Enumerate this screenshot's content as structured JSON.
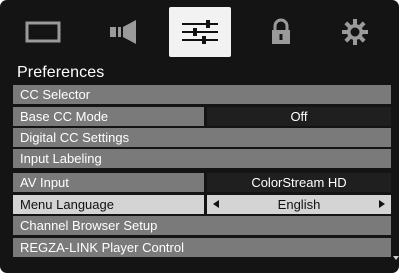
{
  "tabs": [
    {
      "icon": "picture-icon",
      "active": false
    },
    {
      "icon": "sound-icon",
      "active": false
    },
    {
      "icon": "preferences-sliders-icon",
      "active": true
    },
    {
      "icon": "lock-icon",
      "active": false
    },
    {
      "icon": "setup-gear-icon",
      "active": false
    }
  ],
  "menu": {
    "title": "Preferences",
    "items": [
      {
        "label": "CC Selector",
        "value": null
      },
      {
        "label": "Base CC Mode",
        "value": "Off"
      },
      {
        "label": "Digital CC Settings",
        "value": null
      },
      {
        "label": "Input Labeling",
        "value": null
      },
      {
        "label": "AV Input",
        "value": "ColorStream HD"
      },
      {
        "label": "Menu Language",
        "value": "English",
        "selected": true
      },
      {
        "label": "Channel Browser Setup",
        "value": null
      },
      {
        "label": "REGZA-LINK Player Control",
        "value": null
      }
    ]
  },
  "colors": {
    "background": "#141414",
    "row": "#7a7a7a",
    "value_box": "#1f1f1f",
    "selected": "#d4d4d4",
    "active_tab": "#f2f2f2"
  }
}
